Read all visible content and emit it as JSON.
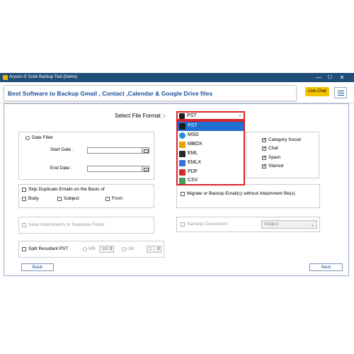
{
  "window": {
    "title": "Aryson G Suite Backup Tool (Demo)",
    "minimize": "—",
    "maximize": "☐",
    "close": "✕"
  },
  "header": {
    "title": "Best Software to Backup Gmail , Contact ,Calendar & Google Drive files",
    "live_chat": "Live Chat"
  },
  "file_format": {
    "label": "Select File Format :-",
    "selected": "PST",
    "options": [
      "PST",
      "MSG",
      "MBOX",
      "EML",
      "EMLX",
      "PDF",
      "CSV"
    ]
  },
  "date_filter": {
    "label": "Date Filter",
    "start_label": "Start Date :",
    "end_label": "End Date :"
  },
  "categories": {
    "items": [
      "Category Social",
      "Chat",
      "Spam",
      "Starred"
    ]
  },
  "skip_duplicates": {
    "label": "Skip Duplicate Emails on the Basis of",
    "options": [
      "Body",
      "Subject",
      "From"
    ]
  },
  "migrate_attachments": {
    "label": "Migrate or Backup Email(s) without Attachment file(s)"
  },
  "save_attachments": {
    "label": "Save Attachments In Separate Folder"
  },
  "naming": {
    "label": "Naming Convention",
    "value": "Subject"
  },
  "split": {
    "label": "Split Resultant PST",
    "mb_label": "MB",
    "mb_value": "200",
    "gb_label": "GB",
    "gb_value": "1"
  },
  "nav": {
    "back": "Back",
    "next": "Next"
  },
  "colors": {
    "titlebar": "#1f4e79",
    "accent": "#1a4f9a",
    "highlight": "#d9232a",
    "live_chat": "#f2c200"
  }
}
